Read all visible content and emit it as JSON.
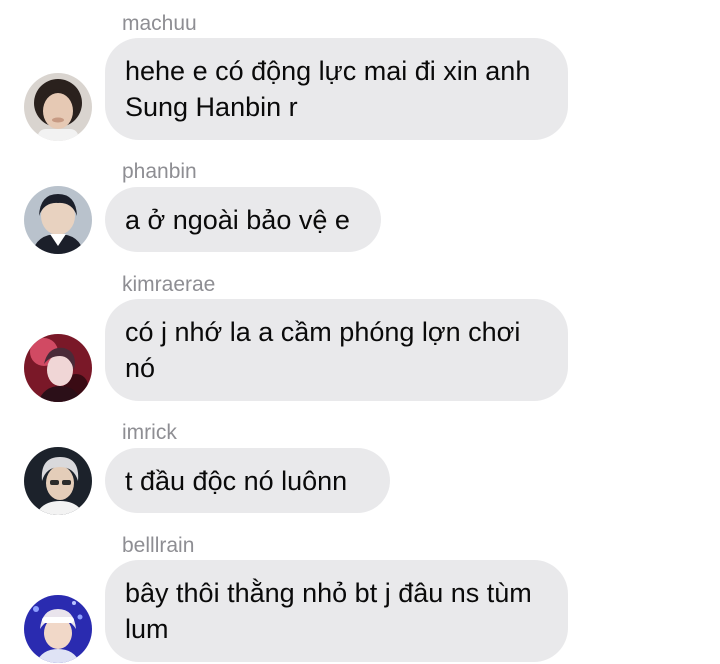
{
  "messages": [
    {
      "sender": "machuu",
      "text": "hehe e có động lực mai đi xin anh Sung Hanbin r",
      "avatar_icon": "user-avatar-machuu-icon",
      "avatar_colors": [
        "#2a211d",
        "#e6c9b4",
        "#c79a83"
      ]
    },
    {
      "sender": "phanbin",
      "text": "a ở ngoài bảo vệ e",
      "avatar_icon": "user-avatar-phanbin-icon",
      "avatar_colors": [
        "#b9c2cc",
        "#1b1f2a",
        "#e8d2c0"
      ]
    },
    {
      "sender": "kimraerae",
      "text": "có j nhớ la a cầm phóng lợn chơi nó",
      "avatar_icon": "user-avatar-kimraerae-icon",
      "avatar_colors": [
        "#7a1828",
        "#d14a63",
        "#f0d6d6"
      ]
    },
    {
      "sender": "imrick",
      "text": "t đầu độc nó luônn",
      "avatar_icon": "user-avatar-imrick-icon",
      "avatar_colors": [
        "#1c222b",
        "#d9d9dc",
        "#e4cdb9"
      ]
    },
    {
      "sender": "belllrain",
      "text": "bây thôi thằng nhỏ bt j đâu ns tùm lum",
      "avatar_icon": "user-avatar-belllrain-icon",
      "avatar_colors": [
        "#2a2bb0",
        "#e9e4ec",
        "#f1d8c8"
      ]
    }
  ]
}
